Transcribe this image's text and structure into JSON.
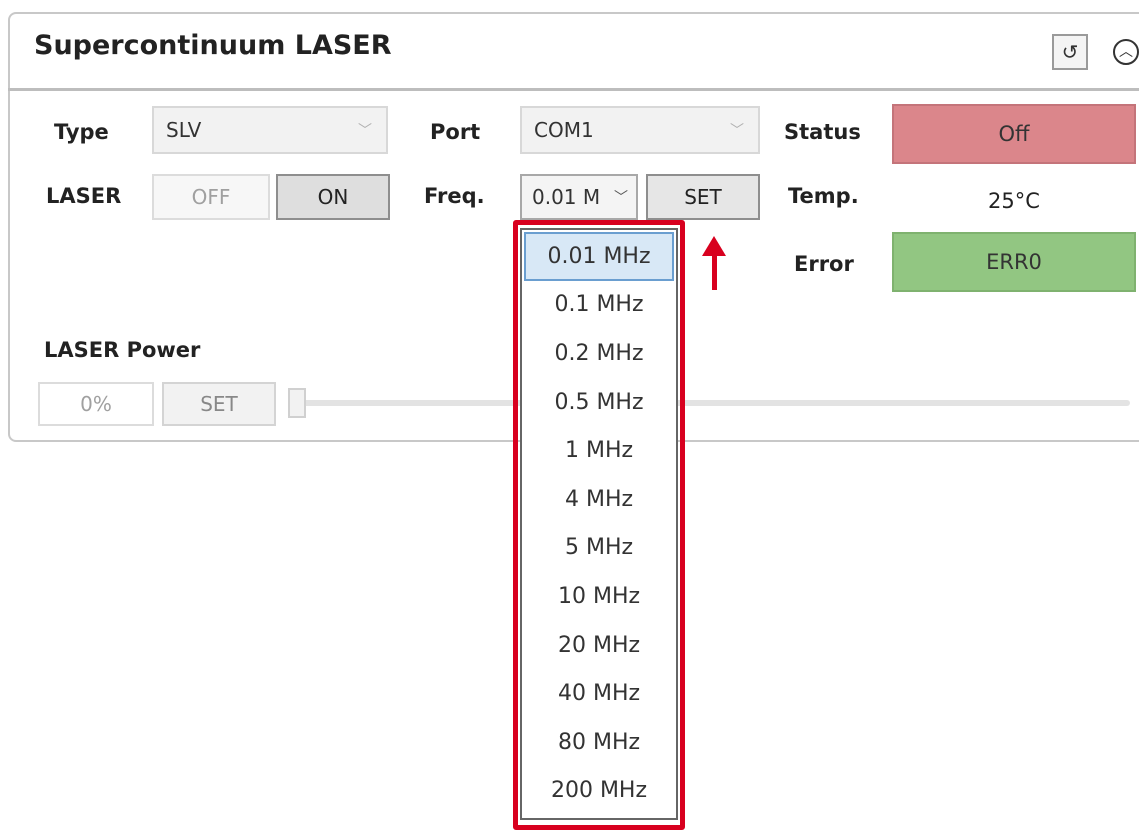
{
  "panel": {
    "title": "Supercontinuum LASER",
    "reset_icon": "reset-icon",
    "collapse_icon": "chevron-up-icon"
  },
  "type": {
    "label": "Type",
    "value": "SLV"
  },
  "port": {
    "label": "Port",
    "value": "COM1"
  },
  "status": {
    "label": "Status",
    "value": "Off",
    "color": "#db868b"
  },
  "laser": {
    "label": "LASER",
    "off_label": "OFF",
    "on_label": "ON"
  },
  "freq": {
    "label": "Freq.",
    "value": "0.01 M",
    "set_label": "SET",
    "options": [
      "0.01 MHz",
      "0.1 MHz",
      "0.2 MHz",
      "0.5 MHz",
      "1 MHz",
      "4 MHz",
      "5 MHz",
      "10 MHz",
      "20 MHz",
      "40 MHz",
      "80 MHz",
      "200 MHz"
    ],
    "selected_index": 0
  },
  "temp": {
    "label": "Temp.",
    "value": "25°C"
  },
  "error": {
    "label": "Error",
    "value": "ERR0",
    "color": "#92c682"
  },
  "power": {
    "label": "LASER Power",
    "value": "0%",
    "set_label": "SET",
    "slider_fraction": 0
  },
  "annotation": {
    "highlight_color": "#d8001f"
  }
}
